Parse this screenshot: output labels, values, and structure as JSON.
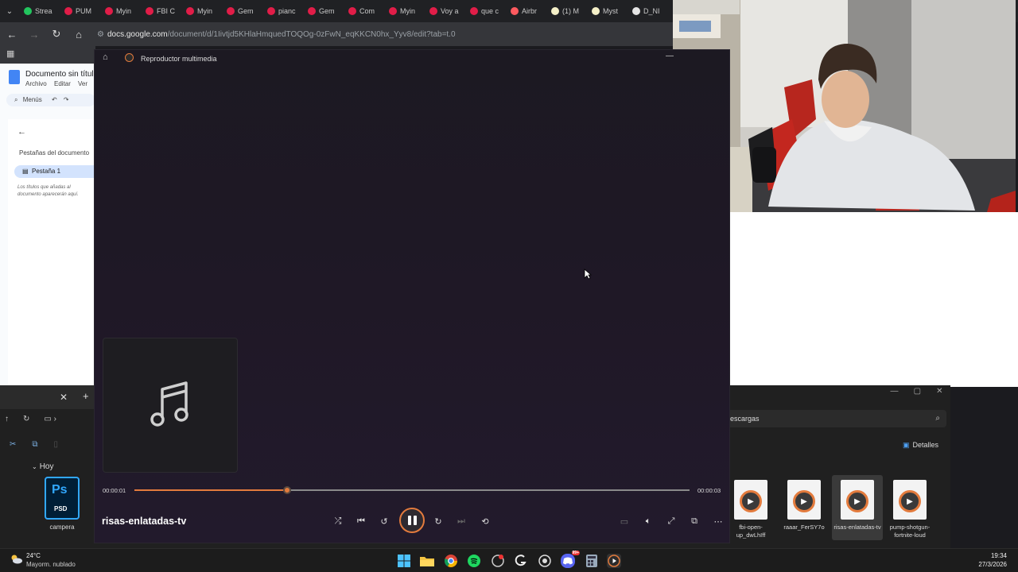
{
  "browser": {
    "tabs": [
      {
        "label": "Strea",
        "color": "#22c55e"
      },
      {
        "label": "PUM",
        "color": "#e11d48"
      },
      {
        "label": "Myin",
        "color": "#e11d48"
      },
      {
        "label": "FBI C",
        "color": "#e11d48"
      },
      {
        "label": "Myin",
        "color": "#e11d48"
      },
      {
        "label": "Gem",
        "color": "#e11d48"
      },
      {
        "label": "pianc",
        "color": "#e11d48"
      },
      {
        "label": "Gem",
        "color": "#e11d48"
      },
      {
        "label": "Com",
        "color": "#e11d48"
      },
      {
        "label": "Myin",
        "color": "#e11d48"
      },
      {
        "label": "Voy a",
        "color": "#e11d48"
      },
      {
        "label": "que c",
        "color": "#e11d48"
      },
      {
        "label": "Airbr",
        "color": "#ff5a5f"
      },
      {
        "label": "(1) M",
        "color": "#f5f0c8"
      },
      {
        "label": "Myst",
        "color": "#f5f0c8"
      },
      {
        "label": "D_NI",
        "color": "#e5e5e5"
      }
    ],
    "url_host": "docs.google.com",
    "url_path": "/document/d/1Iivtjd5KHlaHmquedTOQOg-0zFwN_eqKKCN0hx_Yyv8/edit?tab=t.0"
  },
  "docs": {
    "title": "Documento sin título",
    "menus": [
      "Archivo",
      "Editar",
      "Ver"
    ],
    "toolbar_search": "Menús",
    "tabs_heading": "Pestañas del documento",
    "tab1": "Pestaña 1",
    "hint": "Los títulos que añadas al documento aparecerán aquí."
  },
  "player": {
    "app_title": "Reproductor multimedia",
    "track_name": "risas-enlatadas-tv",
    "time_current": "00:00:01",
    "time_total": "00:00:03",
    "progress": 0.275,
    "accent": "#e37b3d"
  },
  "explorer": {
    "search_placeholder": "escargas",
    "details_label": "Detalles",
    "group_today": "Hoy",
    "psd_file": {
      "badge": "Ps",
      "ext": "PSD",
      "name": "campera"
    },
    "video_files": [
      {
        "name": "fbi-open-up_dwLhIff"
      },
      {
        "name": "raaar_FerSY7o"
      },
      {
        "name": "risas-enlatadas-tv"
      },
      {
        "name": "pump-shotgun-fortnite-loud"
      }
    ]
  },
  "taskbar": {
    "weather_temp": "24°C",
    "weather_desc": "Mayorm. nublado",
    "time": "19:34",
    "date": "27/3/2026",
    "discord_badge": "99+"
  }
}
